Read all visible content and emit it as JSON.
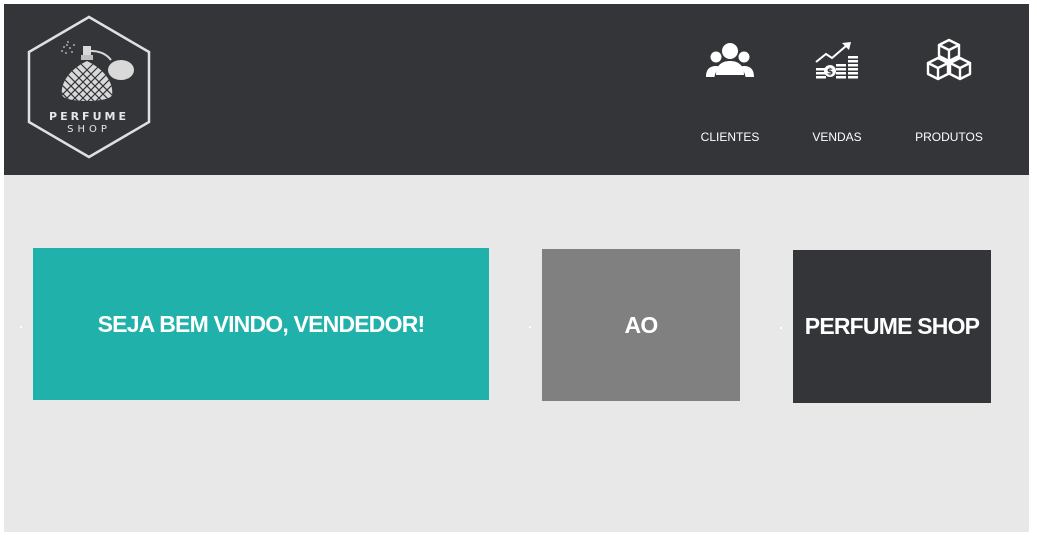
{
  "brand": {
    "logo_line_1": "PERFUME",
    "logo_line_2": "SHOP",
    "logo_icon": "perfume-bottle-hexagon-icon"
  },
  "nav": {
    "items": [
      {
        "label": "CLIENTES",
        "icon": "users-icon"
      },
      {
        "label": "VENDAS",
        "icon": "sales-chart-icon"
      },
      {
        "label": "PRODUTOS",
        "icon": "boxes-icon"
      }
    ]
  },
  "panels": [
    {
      "text": "SEJA BEM VINDO, VENDEDOR!"
    },
    {
      "text": "AO"
    },
    {
      "text": "PERFUME SHOP"
    }
  ],
  "colors": {
    "header_bg": "#333538",
    "page_bg": "#e8e8e8",
    "panel_teal": "#20b2aa",
    "panel_gray": "#808080",
    "panel_dark": "#333538",
    "text": "#ffffff"
  }
}
